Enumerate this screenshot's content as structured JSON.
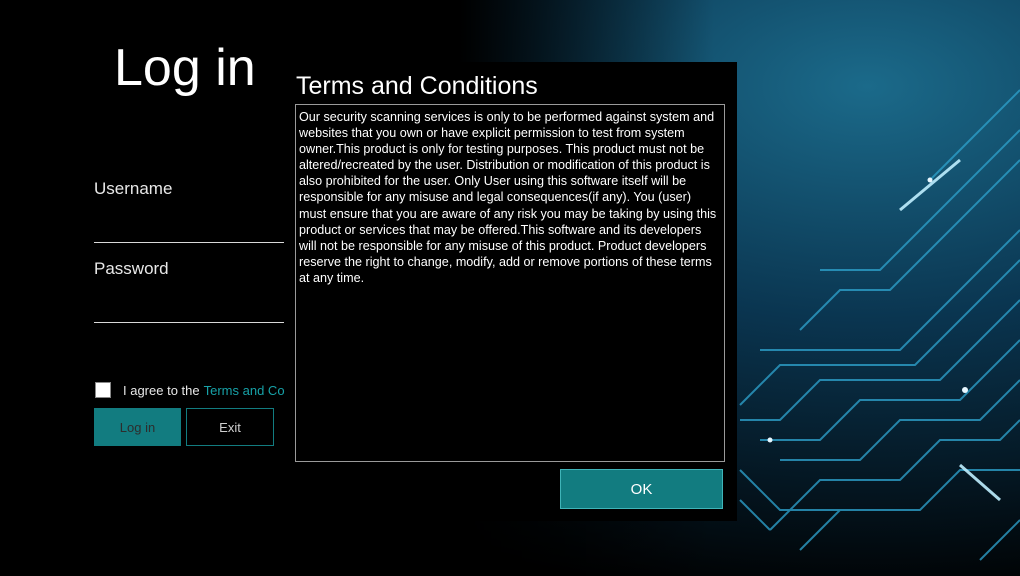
{
  "login": {
    "title": "Log in",
    "username_label": "Username",
    "username_value": "",
    "password_label": "Password",
    "password_value": "",
    "agree_text": "I agree to the",
    "terms_link": "Terms and Co",
    "agree_checked": false,
    "login_button": "Log in",
    "exit_button": "Exit"
  },
  "terms_dialog": {
    "title": "Terms and Conditions",
    "body": "Our security scanning services is only to be performed against system and websites that you own or have explicit permission to test from system owner.This product is only for testing purposes. This product must not be altered/recreated by the user. Distribution or modification of this product is also prohibited for the user. Only User using this software itself will be responsible for any misuse and legal consequences(if any). You (user) must ensure that you are aware of any risk you may be taking by using this product or services that may be offered.This software and its developers will not be responsible for any misuse of this product. Product developers reserve the right to change, modify, add or remove portions of these terms at any time.",
    "ok_button": "OK"
  },
  "colors": {
    "accent": "#127c80",
    "link": "#17a2a8",
    "background": "#000000"
  }
}
